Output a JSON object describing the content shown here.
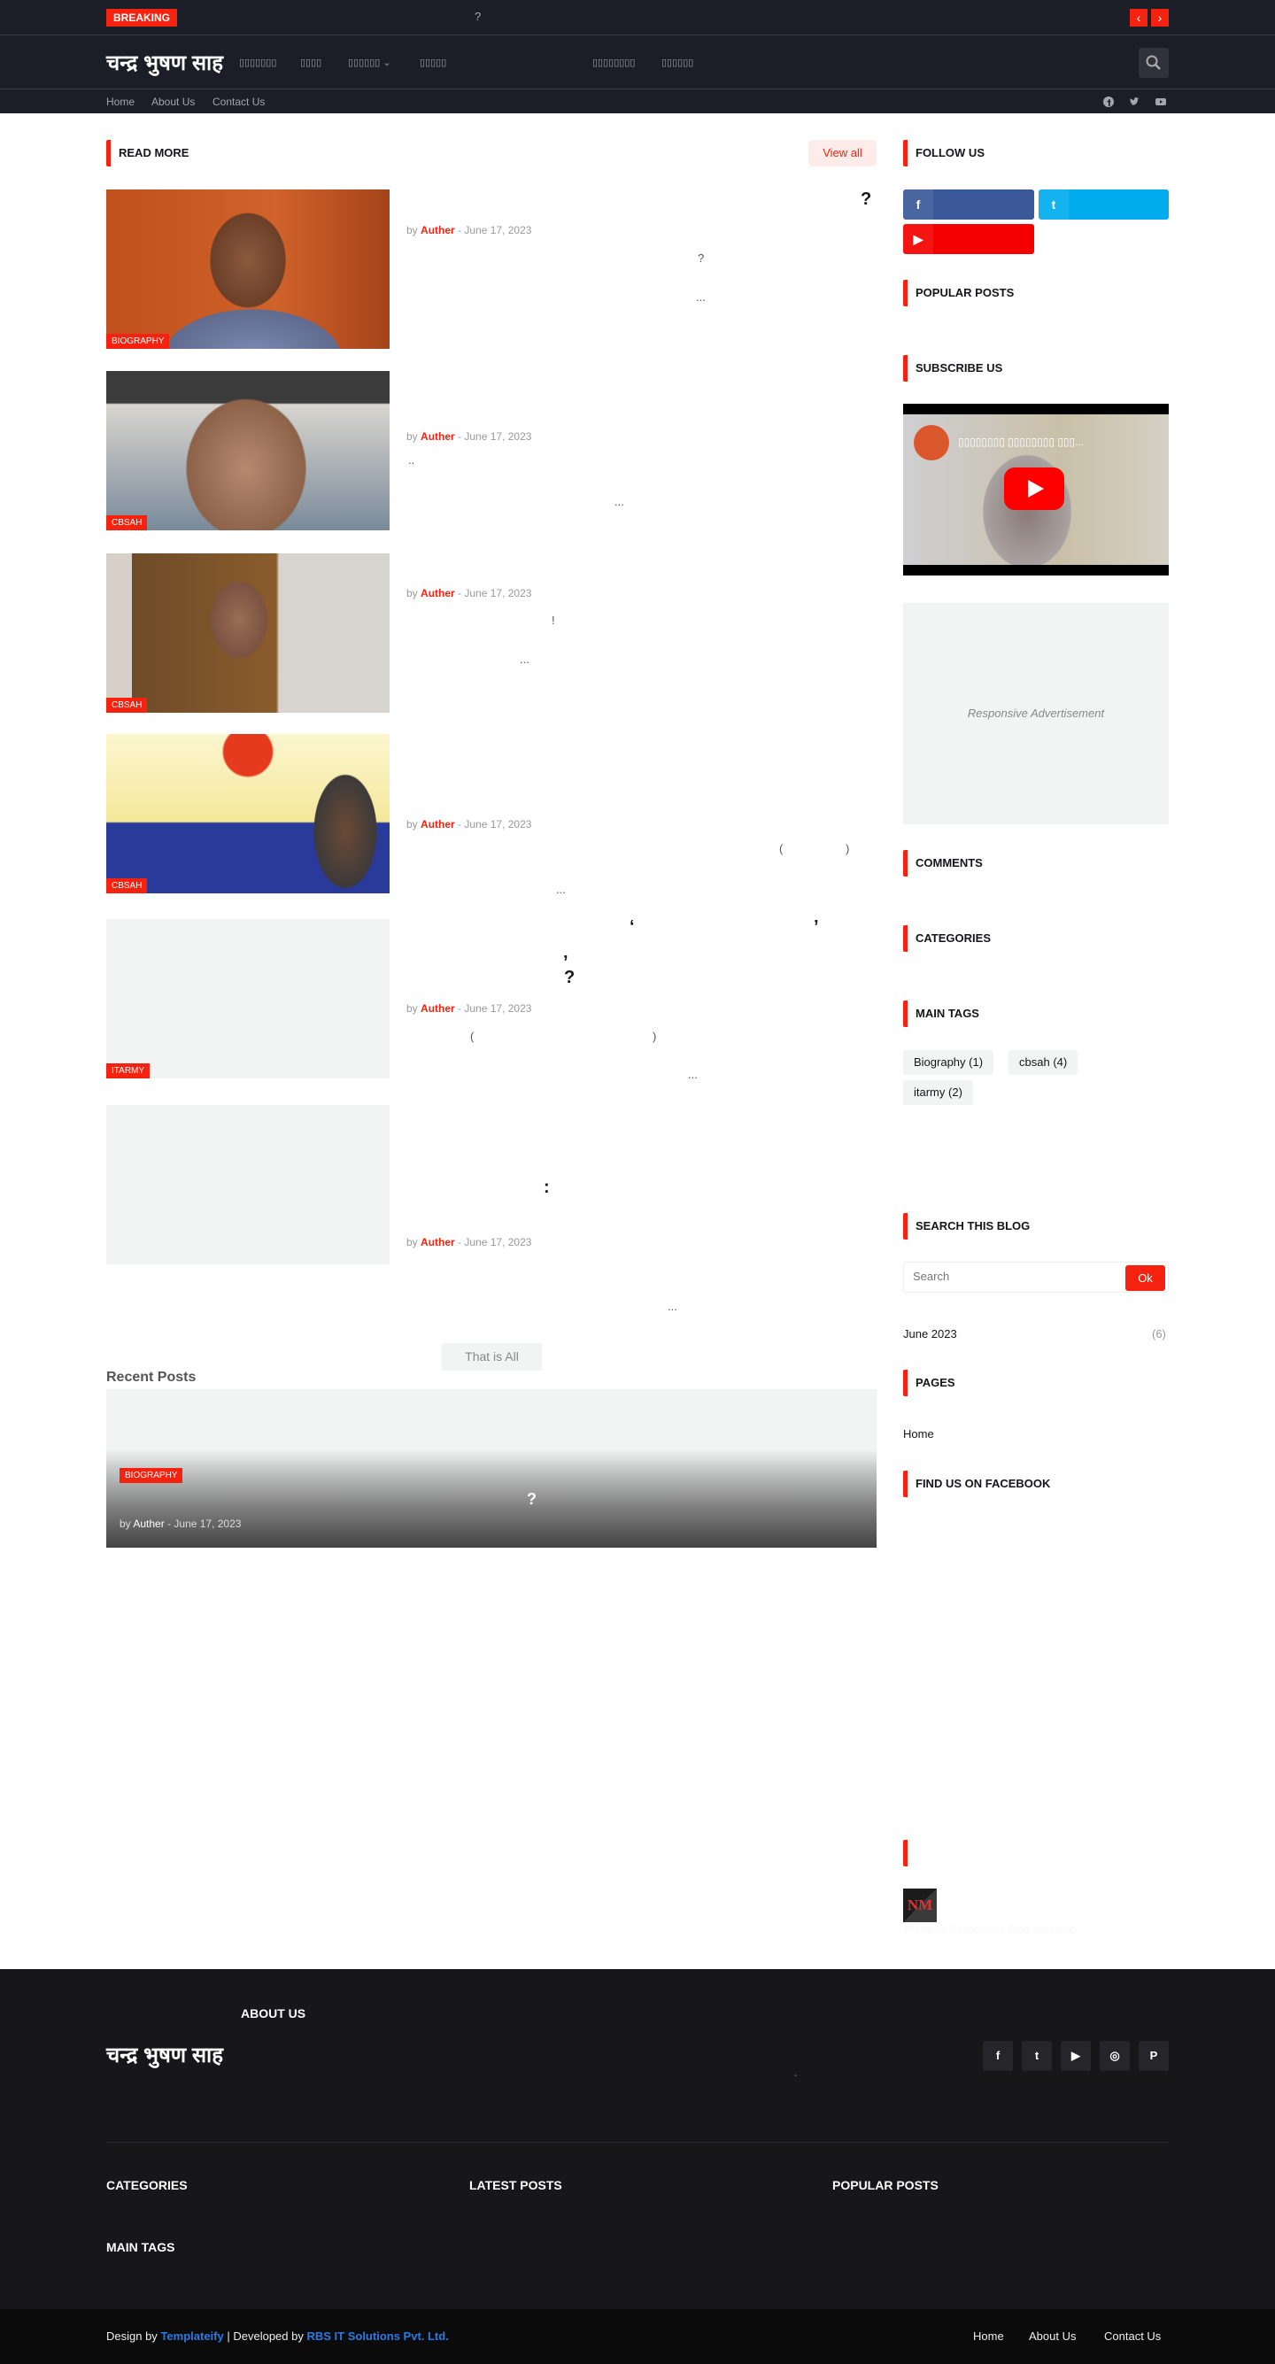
{
  "colors": {
    "accent": "#f5220f",
    "facebook": "#3b5999",
    "twitter": "#00acee",
    "youtube": "#f50000",
    "link": "#2a7ae4"
  },
  "topbar": {
    "breaking": "BREAKING",
    "ticker": "?",
    "prev": "‹",
    "next": "›"
  },
  "header": {
    "logo": "चन्द्र भुषण साह",
    "nav": [
      "▯▯▯▯▯▯▯",
      "▯▯▯▯",
      "▯▯▯▯▯▯",
      "▯▯▯▯▯",
      "▯▯▯▯▯▯▯▯",
      "▯▯▯▯▯▯"
    ],
    "dropdown": "⌄"
  },
  "subnav": {
    "links": [
      "Home",
      "About Us",
      "Contact Us"
    ]
  },
  "main": {
    "section_title": "READ MORE",
    "view_all": "View all",
    "posts": [
      {
        "category": "BIOGRAPHY",
        "title_frag": "?",
        "by": "by",
        "author": "Auther",
        "date": "June 17, 2023",
        "ex1": "?",
        "ex2": "..."
      },
      {
        "category": "CBSAH",
        "by": "by",
        "author": "Auther",
        "date": "June 17, 2023",
        "ex1": "..",
        "ex2": "..."
      },
      {
        "category": "CBSAH",
        "by": "by",
        "author": "Auther",
        "date": "June 17, 2023",
        "ex1": "!",
        "ex2": "..."
      },
      {
        "category": "CBSAH",
        "by": "by",
        "author": "Auther",
        "date": "June 17, 2023",
        "ex1": "(",
        "ex1b": ")",
        "ex2": "..."
      },
      {
        "category": "ITARMY",
        "t1": "‘",
        "t2": "’",
        "t3": "’",
        "title_frag": "?",
        "by": "by",
        "author": "Auther",
        "date": "June 17, 2023",
        "ex1": "(",
        "ex1b": ")",
        "ex2": "..."
      },
      {
        "title_frag": ":",
        "by": "by",
        "author": "Auther",
        "date": "June 17, 2023",
        "ex2": "..."
      }
    ],
    "that_is_all": "That is All",
    "recent_title": "Recent Posts",
    "recent": {
      "category": "BIOGRAPHY",
      "title_frag": "?",
      "by": "by",
      "author": "Auther",
      "date": "June 17, 2023"
    }
  },
  "sidebar": {
    "follow_us": "FOLLOW US",
    "popular_posts": "POPULAR POSTS",
    "subscribe_us": "SUBSCRIBE US",
    "video_title": "▯▯▯▯▯▯▯▯ ▯▯▯▯▯▯▯▯ ▯▯▯...",
    "ad": "Responsive Advertisement",
    "comments": "COMMENTS",
    "categories": "CATEGORIES",
    "main_tags": "MAIN TAGS",
    "tags": [
      {
        "label": "Biography",
        "count": "(1)"
      },
      {
        "label": "cbsah",
        "count": "(4)"
      },
      {
        "label": "itarmy",
        "count": "(2)"
      }
    ],
    "search_title": "SEARCH THIS BLOG",
    "search_placeholder": "Search",
    "search_ok": "Ok",
    "archive": {
      "label": "June 2023",
      "count": "(6)"
    },
    "pages": "PAGES",
    "pages_home": "Home",
    "find_fb": "FIND US ON FACEBOOK",
    "nm_logo": "NM",
    "nm_tagline": "Premium Responsive Blog Template"
  },
  "footer": {
    "about_us": "ABOUT US",
    "logo": "चन्द्र भुषण साह",
    "dash": "-",
    "categories": "CATEGORIES",
    "latest_posts": "LATEST POSTS",
    "popular_posts": "POPULAR POSTS",
    "main_tags": "MAIN TAGS",
    "design_by": "Design by",
    "templateify": "Templateify",
    "sep": "|",
    "developed_by": "Developed by",
    "rbs": "RBS IT Solutions Pvt. Ltd.",
    "links": [
      "Home",
      "About Us",
      "Contact Us"
    ]
  }
}
